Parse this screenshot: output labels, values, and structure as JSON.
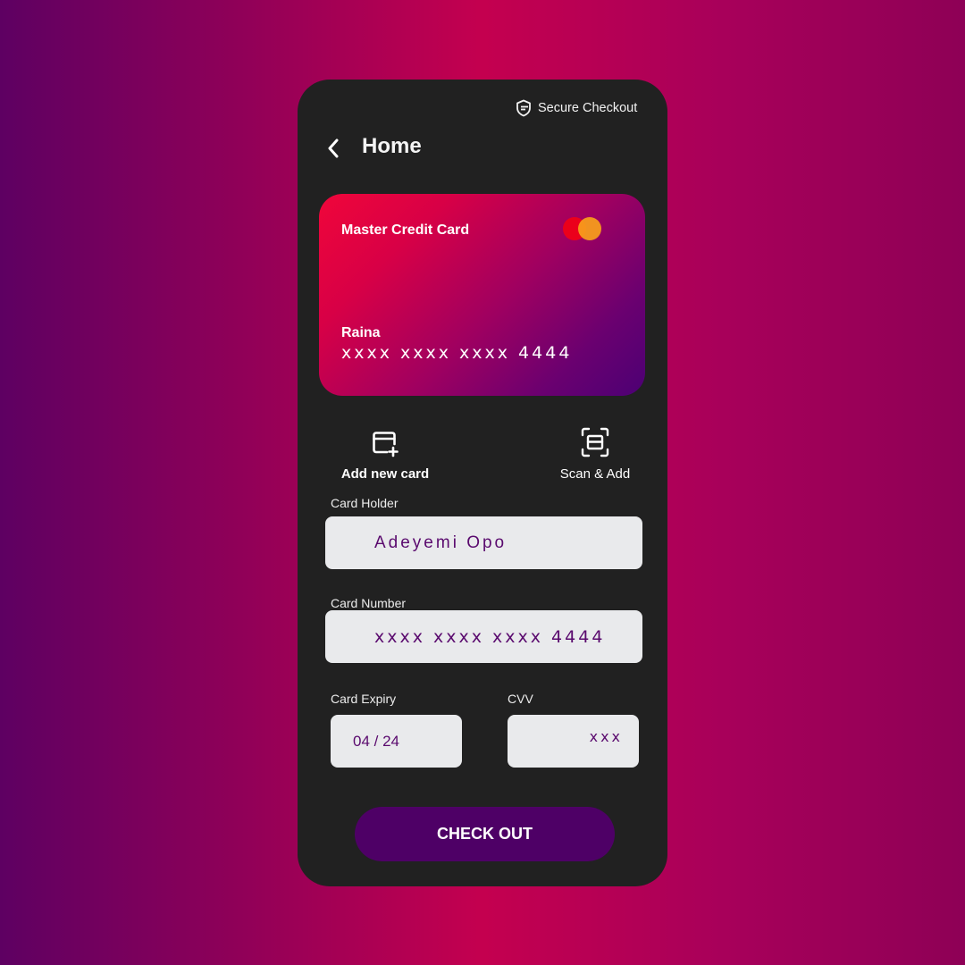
{
  "header": {
    "secure_label": "Secure Checkout",
    "title": "Home"
  },
  "card": {
    "type_label": "Master Credit Card",
    "holder": "Raina",
    "number": "xxxx xxxx xxxx 4444",
    "brand_icon": "mastercard-logo"
  },
  "actions": {
    "add_label": "Add new card",
    "add_icon": "add-card-icon",
    "scan_label": "Scan & Add",
    "scan_icon": "scan-icon"
  },
  "form": {
    "holder_label": "Card Holder",
    "holder_value": "Adeyemi Opo",
    "number_label": "Card Number",
    "number_value": "xxxx xxxx xxxx 4444",
    "expiry_label": "Card Expiry",
    "expiry_value": "04 / 24",
    "cvv_label": "CVV",
    "cvv_value": "xxx"
  },
  "checkout_label": "CHECK OUT",
  "colors": {
    "panel": "#212121",
    "input_bg": "#e9eaec",
    "input_text": "#5a0a6e",
    "button": "#4e0066",
    "card_gradient_start": "#f0063a",
    "card_gradient_end": "#4c0074"
  }
}
